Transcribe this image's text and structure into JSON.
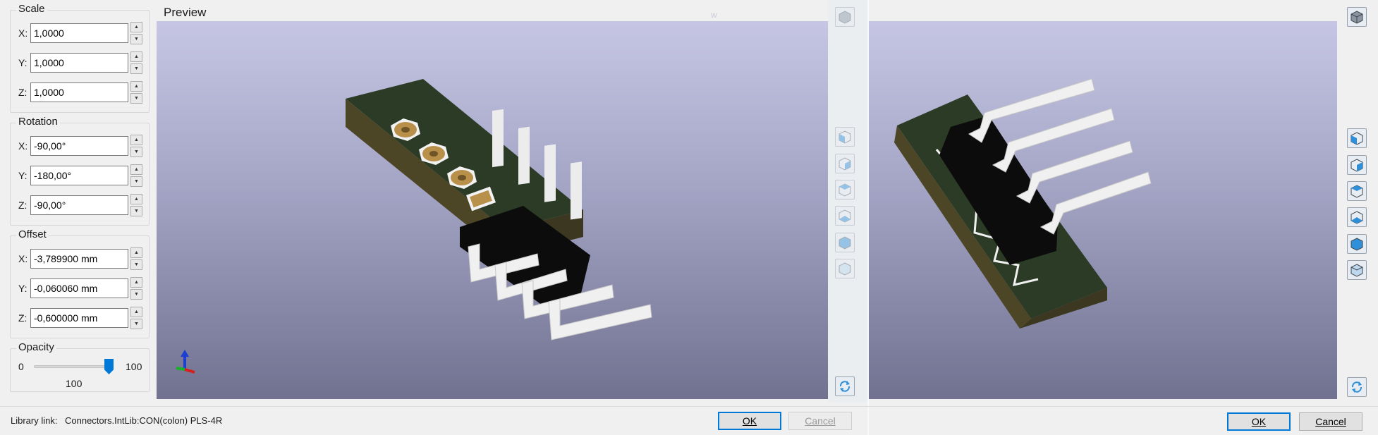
{
  "scale": {
    "title": "Scale",
    "fields": [
      {
        "axis": "X:",
        "value": "1,0000"
      },
      {
        "axis": "Y:",
        "value": "1,0000"
      },
      {
        "axis": "Z:",
        "value": "1,0000"
      }
    ]
  },
  "rotation": {
    "title": "Rotation",
    "fields": [
      {
        "axis": "X:",
        "value": "-90,00°"
      },
      {
        "axis": "Y:",
        "value": "-180,00°"
      },
      {
        "axis": "Z:",
        "value": "-90,00°"
      }
    ]
  },
  "offset": {
    "title": "Offset",
    "fields": [
      {
        "axis": "X:",
        "value": "-3,789900 mm"
      },
      {
        "axis": "Y:",
        "value": "-0,060060 mm"
      },
      {
        "axis": "Z:",
        "value": "-0,600000 mm"
      }
    ]
  },
  "opacity": {
    "title": "Opacity",
    "min_label": "0",
    "max_label": "100",
    "value_label": "100",
    "value": 100
  },
  "preview": {
    "title": "Preview",
    "ghost_label": "w"
  },
  "footer": {
    "library_label": "Library link:",
    "library_value": "Connectors.IntLib:CON(colon) PLS-4R",
    "ok_label": "OK",
    "cancel_label": "Cancel"
  },
  "icons": {
    "spin_up": "▲",
    "spin_down": "▼",
    "view_buttons": [
      "view-front-icon",
      "view-back-icon",
      "view-left-icon",
      "view-right-icon",
      "view-top-icon",
      "view-bottom-icon"
    ],
    "reload": "reload-icon",
    "iso_view": "iso-view-icon"
  },
  "colors": {
    "accent": "#0078d7",
    "pcb_green": "#2b3b25",
    "pad_gold": "#b8904a",
    "pin_white": "#ececec",
    "body_black": "#0c0c0c"
  }
}
